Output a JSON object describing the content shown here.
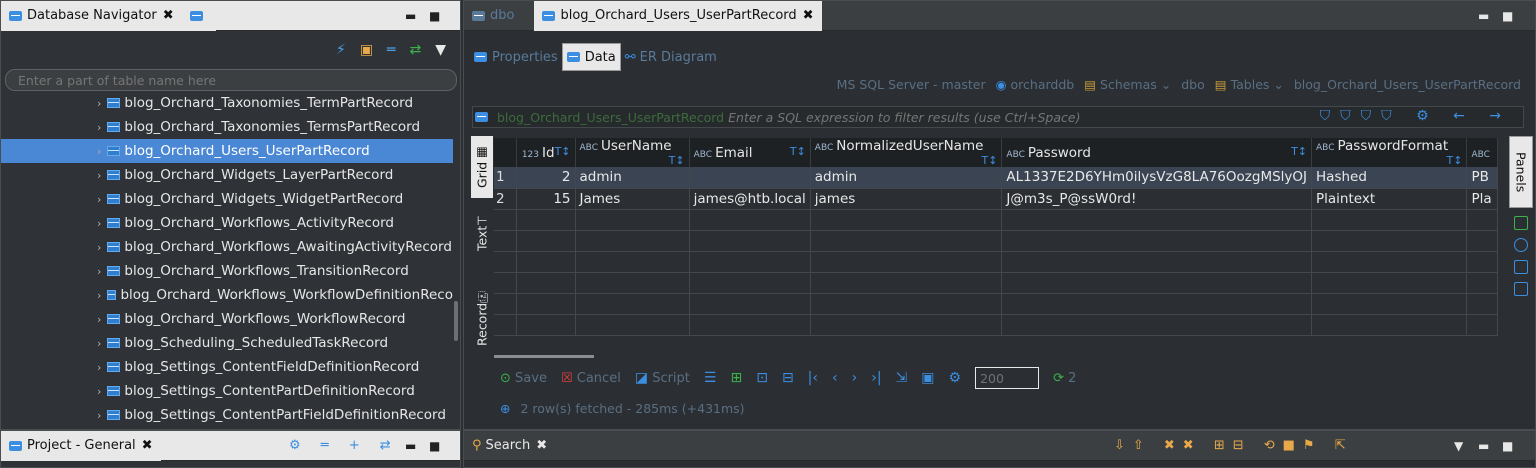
{
  "navigator": {
    "tab_title": "Database Navigator",
    "filter_placeholder": "Enter a part of table name here",
    "items": [
      "blog_Orchard_Taxonomies_TermPartRecord",
      "blog_Orchard_Taxonomies_TermsPartRecord",
      "blog_Orchard_Users_UserPartRecord",
      "blog_Orchard_Widgets_LayerPartRecord",
      "blog_Orchard_Widgets_WidgetPartRecord",
      "blog_Orchard_Workflows_ActivityRecord",
      "blog_Orchard_Workflows_AwaitingActivityRecord",
      "blog_Orchard_Workflows_TransitionRecord",
      "blog_Orchard_Workflows_WorkflowDefinitionReco",
      "blog_Orchard_Workflows_WorkflowRecord",
      "blog_Scheduling_ScheduledTaskRecord",
      "blog_Settings_ContentFieldDefinitionRecord",
      "blog_Settings_ContentPartDefinitionRecord",
      "blog_Settings_ContentPartFieldDefinitionRecord"
    ],
    "selected_index": 2
  },
  "editor": {
    "tabs": [
      {
        "label": "dbo",
        "active": false
      },
      {
        "label": "blog_Orchard_Users_UserPartRecord",
        "active": true
      }
    ],
    "subtabs": {
      "properties": "Properties",
      "data": "Data",
      "er": "ER Diagram"
    },
    "breadcrumb": {
      "server": "MS SQL Server - master",
      "db": "orcharddb",
      "schemas": "Schemas",
      "dbo": "dbo",
      "tables": "Tables",
      "table": "blog_Orchard_Users_UserPartRecord"
    },
    "filter": {
      "table": "blog_Orchard_Users_UserPartRecord",
      "placeholder": "Enter a SQL expression to filter results (use Ctrl+Space)"
    },
    "side_tabs": {
      "grid": "Grid",
      "text": "Text",
      "record": "Record"
    },
    "panels_label": "Panels",
    "columns": [
      "Id",
      "UserName",
      "Email",
      "NormalizedUserName",
      "Password",
      "PasswordFormat",
      "ABC"
    ],
    "rows": [
      {
        "rownum": "1",
        "id": "2",
        "username": "admin",
        "email": "",
        "normalized": "admin",
        "password": "AL1337E2D6YHm0ilysVzG8LA76OozgMSlyOJ",
        "format": "Hashed",
        "extra": "PB"
      },
      {
        "rownum": "2",
        "id": "15",
        "username": "James",
        "email": "james@htb.local",
        "normalized": "james",
        "password": "J@m3s_P@ssW0rd!",
        "format": "Plaintext",
        "extra": "Pla"
      }
    ],
    "toolbar": {
      "save": "Save",
      "cancel": "Cancel",
      "script": "Script",
      "page_size": "200",
      "fetch_count": "2"
    },
    "status": "2 row(s) fetched - 285ms (+431ms)"
  },
  "project": {
    "tab_title": "Project - General"
  },
  "search": {
    "tab_title": "Search"
  }
}
